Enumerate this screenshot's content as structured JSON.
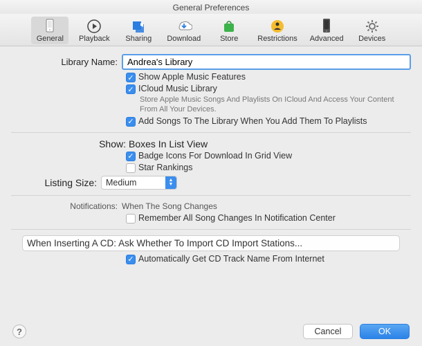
{
  "window": {
    "title": "General Preferences"
  },
  "tabs": [
    {
      "label": "General"
    },
    {
      "label": "Playback"
    },
    {
      "label": "Sharing"
    },
    {
      "label": "Download"
    },
    {
      "label": "Store"
    },
    {
      "label": "Restrictions"
    },
    {
      "label": "Advanced"
    },
    {
      "label": "Devices"
    }
  ],
  "library": {
    "label": "Library Name:",
    "value": "Andrea's Library"
  },
  "options": {
    "show_apple_music": "Show Apple Music Features",
    "icloud_library": "ICloud Music Library",
    "icloud_desc": "Store Apple Music Songs And Playlists On ICloud And Access Your Content From All Your Devices.",
    "add_songs": "Add Songs To The Library When You Add Them To Playlists"
  },
  "show_section": {
    "label": "Show:",
    "value": "Boxes In List View",
    "badge_icons": "Badge Icons For Download In Grid View",
    "star_rankings": "Star Rankings"
  },
  "listing": {
    "label": "Listing Size:",
    "value": "Medium"
  },
  "notifications": {
    "label": "Notifications:",
    "value": "When The Song Changes",
    "remember": "Remember All Song Changes In Notification Center"
  },
  "cd": {
    "label": "When Inserting A CD:",
    "select_value": "Ask Whether To Import CD Import Stations...",
    "auto_get": "Automatically Get CD Track Name From Internet"
  },
  "buttons": {
    "cancel": "Cancel",
    "ok": "OK"
  }
}
